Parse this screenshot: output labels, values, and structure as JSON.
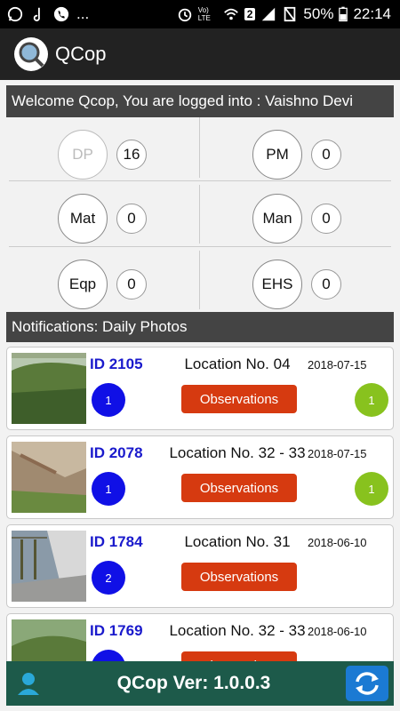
{
  "status_bar": {
    "left_icons": [
      "whatsapp-icon",
      "music-note-icon",
      "phone-icon"
    ],
    "overflow": "...",
    "volte": "Vo) LTE",
    "sim_badge": "2",
    "battery": "50%",
    "time": "22:14"
  },
  "app": {
    "title": "QCop"
  },
  "welcome": {
    "text": "Welcome Qcop, You are logged into : Vaishno Devi"
  },
  "counters": [
    {
      "label": "DP",
      "value": "16",
      "dim": true
    },
    {
      "label": "PM",
      "value": "0"
    },
    {
      "label": "Mat",
      "value": "0"
    },
    {
      "label": "Man",
      "value": "0"
    },
    {
      "label": "Eqp",
      "value": "0"
    },
    {
      "label": "EHS",
      "value": "0"
    }
  ],
  "notifications": {
    "title": "Notifications: Daily Photos"
  },
  "cards": [
    {
      "id": "ID 2105",
      "location": "Location No. 04",
      "date": "2018-07-15",
      "blue_count": "1",
      "green_count": "1",
      "button": "Observations"
    },
    {
      "id": "ID 2078",
      "location": "Location No. 32 - 33",
      "date": "2018-07-15",
      "blue_count": "1",
      "green_count": "1",
      "button": "Observations"
    },
    {
      "id": "ID 1784",
      "location": "Location No. 31",
      "date": "2018-06-10",
      "blue_count": "2",
      "green_count": "",
      "button": "Observations"
    },
    {
      "id": "ID 1769",
      "location": "Location No. 32 - 33",
      "date": "2018-06-10",
      "blue_count": "",
      "green_count": "",
      "button": "Observations"
    }
  ],
  "footer": {
    "version": "QCop Ver: 1.0.0.3"
  },
  "colors": {
    "header": "#444444",
    "appbar": "#222222",
    "footer": "#1d5a4a",
    "button": "#d63a10",
    "blue_badge": "#1010e6",
    "green_badge": "#88c21e",
    "id_text": "#1a1acc"
  }
}
